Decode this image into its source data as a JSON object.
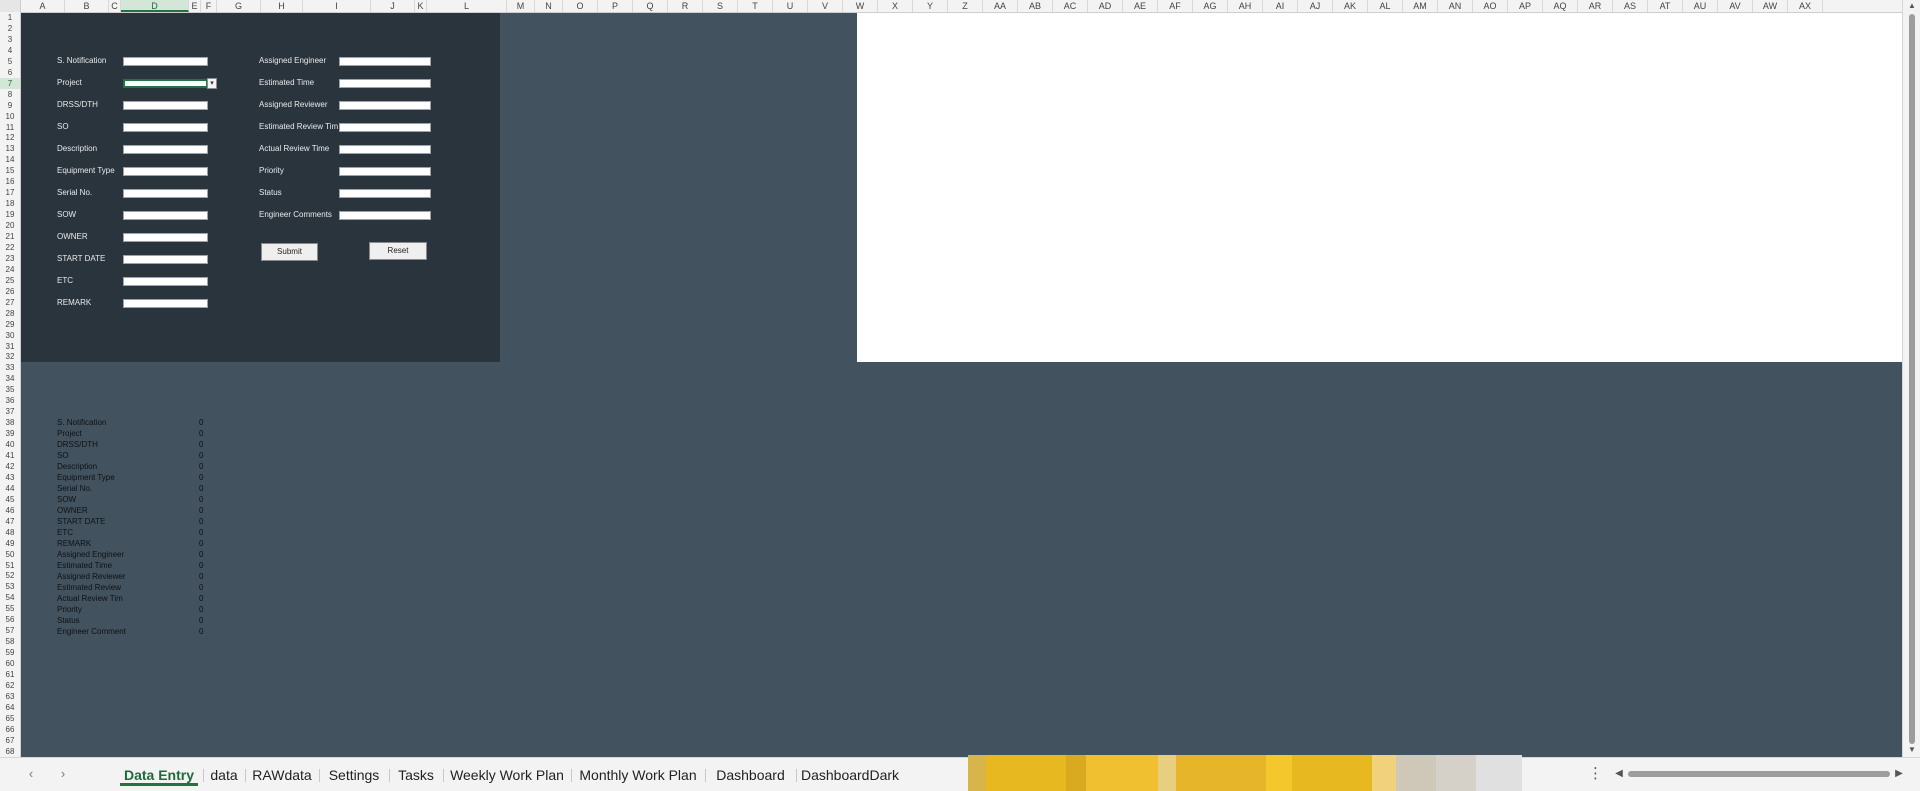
{
  "columns": [
    "A",
    "B",
    "C",
    "D",
    "E",
    "F",
    "G",
    "H",
    "I",
    "J",
    "K",
    "L",
    "M",
    "N",
    "O",
    "P",
    "Q",
    "R",
    "S",
    "T",
    "U",
    "V",
    "W",
    "X",
    "Y",
    "Z",
    "AA",
    "AB",
    "AC",
    "AD",
    "AE",
    "AF",
    "AG",
    "AH",
    "AI",
    "AJ",
    "AK",
    "AL",
    "AM",
    "AN",
    "AO",
    "AP",
    "AQ",
    "AR",
    "AS",
    "AT",
    "AU",
    "AV",
    "AW",
    "AX"
  ],
  "active_column": "D",
  "row_count": 68,
  "active_row": 7,
  "form": {
    "left_fields": [
      {
        "label": "S. Notification",
        "value": ""
      },
      {
        "label": "Project",
        "value": ""
      },
      {
        "label": "DRSS/DTH",
        "value": ""
      },
      {
        "label": "SO",
        "value": ""
      },
      {
        "label": "Description",
        "value": ""
      },
      {
        "label": "Equipment Type",
        "value": ""
      },
      {
        "label": "Serial No.",
        "value": ""
      },
      {
        "label": "SOW",
        "value": ""
      },
      {
        "label": "OWNER",
        "value": ""
      },
      {
        "label": "START DATE",
        "value": ""
      },
      {
        "label": "ETC",
        "value": ""
      },
      {
        "label": "REMARK",
        "value": ""
      }
    ],
    "right_fields": [
      {
        "label": "Assigned Engineer",
        "value": ""
      },
      {
        "label": "Estimated Time",
        "value": ""
      },
      {
        "label": "Assigned Reviewer",
        "value": ""
      },
      {
        "label": "Estimated Review Tim",
        "value": ""
      },
      {
        "label": "Actual Review Time",
        "value": ""
      },
      {
        "label": "Priority",
        "value": ""
      },
      {
        "label": "Status",
        "value": ""
      },
      {
        "label": "Engineer Comments",
        "value": ""
      }
    ],
    "submit_label": "Submit",
    "reset_label": "Reset"
  },
  "summary": [
    {
      "label": "S. Notification",
      "value": "0"
    },
    {
      "label": "Project",
      "value": "0"
    },
    {
      "label": "DRSS/DTH",
      "value": "0"
    },
    {
      "label": "SO",
      "value": "0"
    },
    {
      "label": "Description",
      "value": "0"
    },
    {
      "label": "Equipment Type",
      "value": "0"
    },
    {
      "label": "Serial No.",
      "value": "0"
    },
    {
      "label": "SOW",
      "value": "0"
    },
    {
      "label": "OWNER",
      "value": "0"
    },
    {
      "label": "START DATE",
      "value": "0"
    },
    {
      "label": "ETC",
      "value": "0"
    },
    {
      "label": "REMARK",
      "value": "0"
    },
    {
      "label": "Assigned Engineer",
      "value": "0"
    },
    {
      "label": "Estimated Time",
      "value": "0"
    },
    {
      "label": "Assigned Reviewer",
      "value": "0"
    },
    {
      "label": "Estimated Review",
      "value": "0"
    },
    {
      "label": "Actual Review Tim",
      "value": "0"
    },
    {
      "label": "Priority",
      "value": "0"
    },
    {
      "label": "Status",
      "value": "0"
    },
    {
      "label": "Engineer Comment",
      "value": "0"
    }
  ],
  "tabs": [
    {
      "label": "Data Entry",
      "active": true
    },
    {
      "label": "data",
      "active": false
    },
    {
      "label": "RAWdata",
      "active": false
    },
    {
      "label": "Settings",
      "active": false
    },
    {
      "label": "Tasks",
      "active": false
    },
    {
      "label": "Weekly Work Plan",
      "active": false
    },
    {
      "label": "Monthly Work Plan",
      "active": false
    },
    {
      "label": "Dashboard",
      "active": false
    },
    {
      "label": "DashboardDark",
      "active": false
    }
  ],
  "icons": {
    "prev_sheet": "chevron-left-icon",
    "next_sheet": "chevron-right-icon",
    "more": "more-options-icon",
    "dropdown": "chevron-down-icon",
    "scroll_left": "scroll-left-arrow-icon",
    "scroll_right": "scroll-right-arrow-icon"
  },
  "colors": {
    "sheet_background": "#43525f",
    "form_panel": "#2a343c",
    "accent_green": "#217346",
    "redacted_block": "#e8b820"
  }
}
